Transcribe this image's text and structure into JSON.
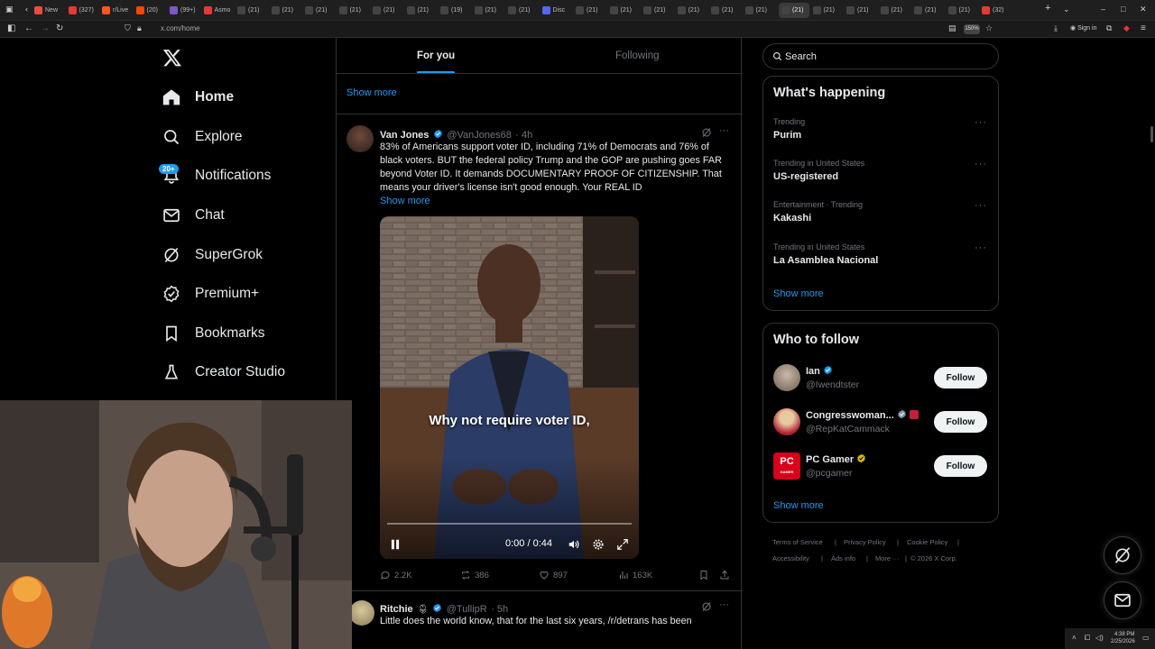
{
  "browser": {
    "tabs": [
      {
        "label": "New",
        "color": "#e74c3c"
      },
      {
        "label": "(327)",
        "color": "#e53935"
      },
      {
        "label": "r/Live",
        "color": "#ff5722"
      },
      {
        "label": "(20)",
        "color": "#ff4500"
      },
      {
        "label": "(99+)",
        "color": "#7e57c2"
      },
      {
        "label": "Asmo",
        "color": "#e53935"
      },
      {
        "label": "(21)",
        "color": "#444"
      },
      {
        "label": "(21)",
        "color": "#444"
      },
      {
        "label": "(21)",
        "color": "#444"
      },
      {
        "label": "(21)",
        "color": "#444"
      },
      {
        "label": "(21)",
        "color": "#444"
      },
      {
        "label": "(21)",
        "color": "#444"
      },
      {
        "label": "(19)",
        "color": "#444"
      },
      {
        "label": "(21)",
        "color": "#444"
      },
      {
        "label": "(21)",
        "color": "#444"
      },
      {
        "label": "Disc",
        "color": "#5865f2"
      },
      {
        "label": "(21)",
        "color": "#444"
      },
      {
        "label": "(21)",
        "color": "#444"
      },
      {
        "label": "(21)",
        "color": "#444"
      },
      {
        "label": "(21)",
        "color": "#444"
      },
      {
        "label": "(21)",
        "color": "#444"
      },
      {
        "label": "(21)",
        "color": "#444"
      },
      {
        "label": "(21)",
        "color": "#444"
      },
      {
        "label": "(21)",
        "color": "#444"
      },
      {
        "label": "(21)",
        "color": "#444"
      },
      {
        "label": "(21)",
        "color": "#444"
      },
      {
        "label": "(21)",
        "color": "#444"
      },
      {
        "label": "(21)",
        "color": "#444"
      },
      {
        "label": "(32)",
        "color": "#e53935"
      }
    ],
    "url": "x.com/home",
    "zoom": "150%",
    "signin": "Sign in"
  },
  "nav": {
    "home": "Home",
    "explore": "Explore",
    "notifications": "Notifications",
    "notifications_badge": "20+",
    "chat": "Chat",
    "supergrok": "SuperGrok",
    "premium": "Premium+",
    "bookmarks": "Bookmarks",
    "creator_studio": "Creator Studio"
  },
  "feed": {
    "tab_foryou": "For you",
    "tab_following": "Following",
    "show_more_top": "Show more",
    "tweet1": {
      "name": "Van Jones",
      "handle": "@VanJones68",
      "time": "· 4h",
      "text": "83% of Americans support voter ID, including 71% of Democrats and 76% of black voters. BUT the federal policy Trump and the GOP are pushing goes FAR beyond Voter ID. It demands DOCUMENTARY PROOF OF CITIZENSHIP. That means your driver's license isn't good enough. Your REAL ID",
      "show_more": "Show more",
      "caption": "Why not require voter ID,",
      "video_time": "0:00 / 0:44",
      "video_progress": 0.0,
      "replies": "2.2K",
      "reposts": "386",
      "likes": "897",
      "views": "163K"
    },
    "tweet2": {
      "name": "Ritchie",
      "handle": "@TullipR",
      "time": "· 5h",
      "text": "Little does the world know, that for the last six years, /r/detrans has been"
    }
  },
  "sidebar": {
    "search_placeholder": "Search",
    "happening_title": "What's happening",
    "trends": [
      {
        "context": "Trending",
        "name": "Purim"
      },
      {
        "context": "Trending in United States",
        "name": "US-registered"
      },
      {
        "context": "Entertainment · Trending",
        "name": "Kakashi"
      },
      {
        "context": "Trending in United States",
        "name": "La Asamblea Nacional"
      }
    ],
    "trends_show_more": "Show more",
    "wtf_title": "Who to follow",
    "wtf": [
      {
        "name": "Ian",
        "handle": "@Iwendtster",
        "follow": "Follow"
      },
      {
        "name": "Congresswoman...",
        "handle": "@RepKatCammack",
        "follow": "Follow"
      },
      {
        "name": "PC Gamer",
        "handle": "@pcgamer",
        "follow": "Follow"
      }
    ],
    "pcgamer_avatar_text": "PC",
    "pcgamer_avatar_sub": "GAMER",
    "wtf_show_more": "Show more",
    "footer": [
      "Terms of Service",
      "Privacy Policy",
      "Cookie Policy",
      "Accessibility",
      "Ads info",
      "More ···",
      "© 2026 X Corp."
    ]
  },
  "taskbar": {
    "time": "4:38 PM",
    "date": "2/25/2026"
  }
}
